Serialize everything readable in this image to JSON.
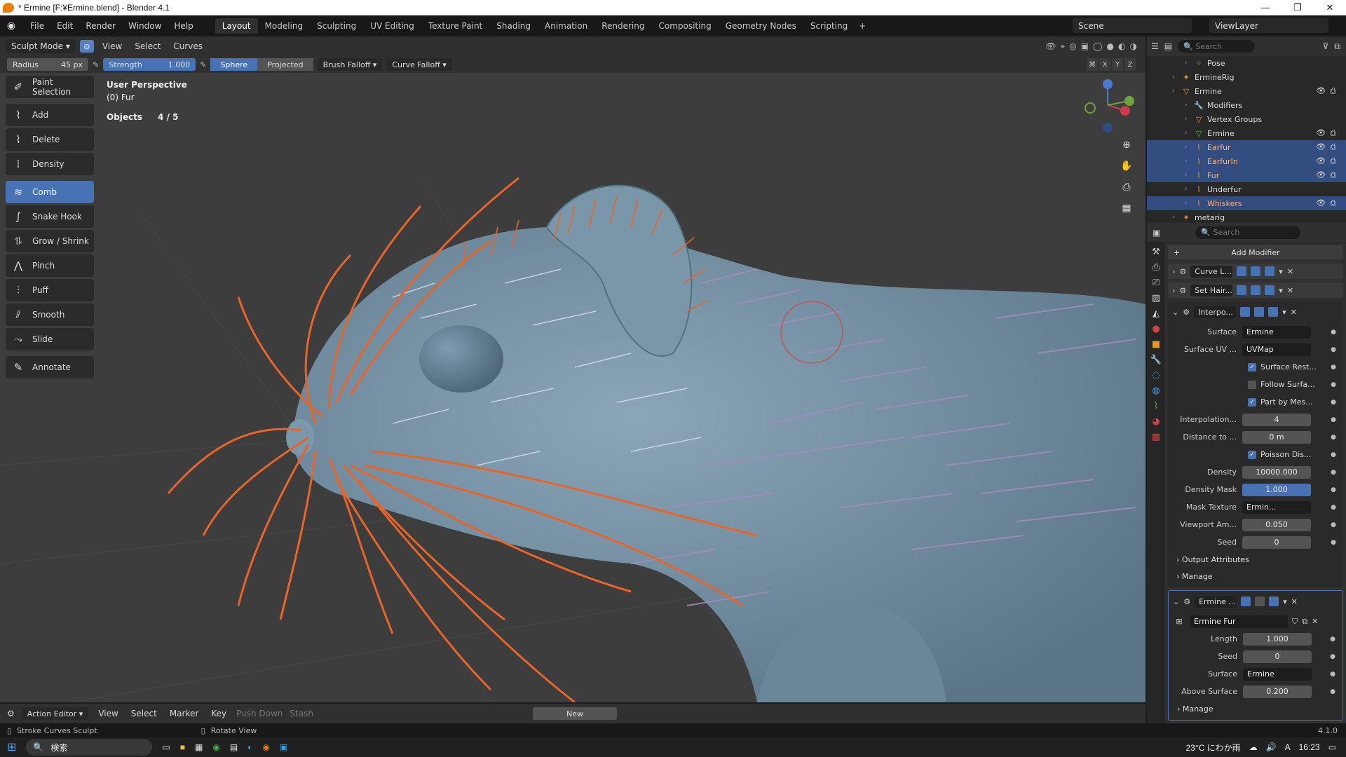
{
  "window": {
    "title": "* Ermine [F:¥Ermine.blend] - Blender 4.1",
    "controls": [
      "—",
      "❐",
      "✕"
    ]
  },
  "topmenu": {
    "menus": [
      "File",
      "Edit",
      "Render",
      "Window",
      "Help"
    ],
    "workspaces": [
      "Layout",
      "Modeling",
      "Sculpting",
      "UV Editing",
      "Texture Paint",
      "Shading",
      "Animation",
      "Rendering",
      "Compositing",
      "Geometry Nodes",
      "Scripting",
      "+"
    ],
    "active_workspace": "Layout",
    "scene": "Scene",
    "view_layer": "ViewLayer"
  },
  "viewport_header": {
    "mode": "Sculpt Mode",
    "menus": [
      "View",
      "Select",
      "Curves"
    ]
  },
  "tool_settings": {
    "radius_label": "Radius",
    "radius_value": "45 px",
    "strength_label": "Strength",
    "strength_value": "1.000",
    "sphere": "Sphere",
    "projected": "Projected",
    "brush_falloff": "Brush Falloff",
    "curve_falloff": "Curve Falloff",
    "axes": [
      "X",
      "Y",
      "Z"
    ]
  },
  "toolbar": {
    "items": [
      {
        "label": "Paint Selection",
        "icon": "paint-selection-icon"
      },
      {
        "label": "Add",
        "icon": "add-curves-icon"
      },
      {
        "label": "Delete",
        "icon": "delete-curves-icon"
      },
      {
        "label": "Density",
        "icon": "density-icon"
      },
      {
        "label": "Comb",
        "icon": "comb-icon"
      },
      {
        "label": "Snake Hook",
        "icon": "snake-hook-icon"
      },
      {
        "label": "Grow / Shrink",
        "icon": "grow-shrink-icon"
      },
      {
        "label": "Pinch",
        "icon": "pinch-icon"
      },
      {
        "label": "Puff",
        "icon": "puff-icon"
      },
      {
        "label": "Smooth",
        "icon": "smooth-icon"
      },
      {
        "label": "Slide",
        "icon": "slide-icon"
      },
      {
        "label": "Annotate",
        "icon": "annotate-icon"
      }
    ],
    "active": "Comb"
  },
  "viewport_info": {
    "view": "User Perspective",
    "object": "(0) Fur",
    "objects_label": "Objects",
    "objects_value": "4 / 5"
  },
  "outliner": {
    "search_placeholder": "Search",
    "rows": [
      {
        "label": "Pose",
        "indent": 3,
        "icon": "pose-icon",
        "selected": false
      },
      {
        "label": "ErmineRig",
        "indent": 2,
        "icon": "armature-icon",
        "selected": false
      },
      {
        "label": "Ermine",
        "indent": 2,
        "icon": "mesh-object-icon",
        "selected": false
      },
      {
        "label": "Modifiers",
        "indent": 3,
        "icon": "wrench-icon",
        "selected": false
      },
      {
        "label": "Vertex Groups",
        "indent": 3,
        "icon": "vertex-groups-icon",
        "selected": false
      },
      {
        "label": "Ermine",
        "indent": 3,
        "icon": "mesh-data-icon",
        "selected": false
      },
      {
        "label": "Earfur",
        "indent": 3,
        "icon": "curves-icon",
        "selected": true
      },
      {
        "label": "EarfurIn",
        "indent": 3,
        "icon": "curves-icon",
        "selected": true
      },
      {
        "label": "Fur",
        "indent": 3,
        "icon": "curves-icon",
        "selected": true
      },
      {
        "label": "Underfur",
        "indent": 3,
        "icon": "curves-icon",
        "selected": false
      },
      {
        "label": "Whiskers",
        "indent": 3,
        "icon": "curves-icon",
        "selected": true
      },
      {
        "label": "metarig",
        "indent": 2,
        "icon": "armature-icon",
        "selected": false
      }
    ]
  },
  "properties": {
    "search_placeholder": "Search",
    "add_modifier": "Add Modifier",
    "modifiers": [
      "Curve L...",
      "Set Hair...",
      "Interpo..."
    ],
    "interp_fields": [
      {
        "label": "Surface",
        "value": "Ermine",
        "kind": "dark"
      },
      {
        "label": "Surface UV ...",
        "value": "UVMap",
        "kind": "dark"
      },
      {
        "label": "",
        "value": "Surface Rest...",
        "kind": "check"
      },
      {
        "label": "",
        "value": "Follow Surfa...",
        "kind": "check-off"
      },
      {
        "label": "",
        "value": "Part by Mes...",
        "kind": "check"
      },
      {
        "label": "Interpolation...",
        "value": "4",
        "kind": "num"
      },
      {
        "label": "Distance to ...",
        "value": "0 m",
        "kind": "num"
      },
      {
        "label": "",
        "value": "Poisson Dis...",
        "kind": "check"
      },
      {
        "label": "Density",
        "value": "10000.000",
        "kind": "num"
      },
      {
        "label": "Density Mask",
        "value": "1.000",
        "kind": "blue"
      },
      {
        "label": "Mask Texture",
        "value": "Ermin...",
        "kind": "dark"
      },
      {
        "label": "Viewport Am...",
        "value": "0.050",
        "kind": "num"
      },
      {
        "label": "Seed",
        "value": "0",
        "kind": "num"
      }
    ],
    "subpanels1": [
      "Output Attributes",
      "Manage"
    ],
    "modifier4": "Ermine ...",
    "nodegroup": "Ermine Fur",
    "fur_fields": [
      {
        "label": "Length",
        "value": "1.000",
        "kind": "num"
      },
      {
        "label": "Seed",
        "value": "0",
        "kind": "num"
      },
      {
        "label": "Surface",
        "value": "Ermine",
        "kind": "dark"
      },
      {
        "label": "Above Surface",
        "value": "0.200",
        "kind": "num"
      }
    ],
    "subpanels2": [
      "Manage"
    ]
  },
  "timeline": {
    "editor": "Action Editor",
    "menus": [
      "View",
      "Select",
      "Marker",
      "Key"
    ],
    "push_down": "Push Down",
    "stash": "Stash",
    "new": "New"
  },
  "statusbar": {
    "left": "Stroke Curves Sculpt",
    "mid": "Rotate View",
    "version": "4.1.0"
  },
  "taskbar": {
    "search": "検索",
    "weather": "23°C にわか雨",
    "time": "16:23"
  },
  "colors": {
    "accent": "#4772b3",
    "whisker": "#e8652a",
    "fur_purple": "#9b7fb2",
    "mesh": "#6f8ea0"
  }
}
